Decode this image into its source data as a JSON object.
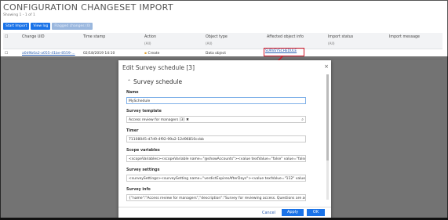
{
  "page": {
    "title": "CONFIGURATION CHANGESET IMPORT",
    "showing": "Showing 1 - 1 of 1"
  },
  "toolbar": {
    "start_import": "Start Import",
    "view_log": "View log",
    "flag_changes": "Flagged changes (0)"
  },
  "table": {
    "columns": [
      {
        "label": "Change UID",
        "filter": ""
      },
      {
        "label": "Time stamp",
        "filter": ""
      },
      {
        "label": "Action",
        "filter": "(All)"
      },
      {
        "label": "Object type",
        "filter": "(All)"
      },
      {
        "label": "Affected object info",
        "filter": ""
      },
      {
        "label": "Import status",
        "filter": "(All)"
      },
      {
        "label": "Import message",
        "filter": ""
      }
    ],
    "rows": [
      {
        "change_uid": "a0d9b0a2-a055-41be-8559-...",
        "time_stamp": "02/18/2019 14:10",
        "action": "Create",
        "object_type": "Data object",
        "affected_object": "SURVEYSCHEDULE",
        "import_status": "",
        "import_message": ""
      }
    ]
  },
  "modal": {
    "title": "Edit Survey schedule [3]",
    "section": "Survey schedule",
    "fields": {
      "name_label": "Name",
      "name_value": "MySchedule",
      "template_label": "Survey template",
      "template_value": "Access review for managers [3]",
      "timer_label": "Timer",
      "timer_value": "71108045-d7d9-4f92-99a2-12d96810ccbb",
      "scope_label": "Scope variables",
      "scope_value": "<scopeVariables><scopeVariable name=\"@showAccounts\"><value textValue=\"false\" value=\"false\"></va",
      "settings_label": "Survey settings",
      "settings_value": "<surveySettings><surveySetting name=\"verdictExpiresAfterDays\"><value textValue=\"112\" value=\"112\">",
      "info_label": "Survey info",
      "info_value": "{\"name\":\"Access review for managers\",\"description\":\"Survey for reviewing access. Questions are assign"
    },
    "cancel": "Cancel",
    "apply": "Apply",
    "ok": "OK"
  },
  "icons": {
    "close": "close-icon",
    "collapse": "chevron-up-icon",
    "search": "search-icon",
    "remove": "remove-icon"
  },
  "colors": {
    "primary": "#1a73e8",
    "highlight": "#d1182a",
    "link": "#2a5db0"
  }
}
